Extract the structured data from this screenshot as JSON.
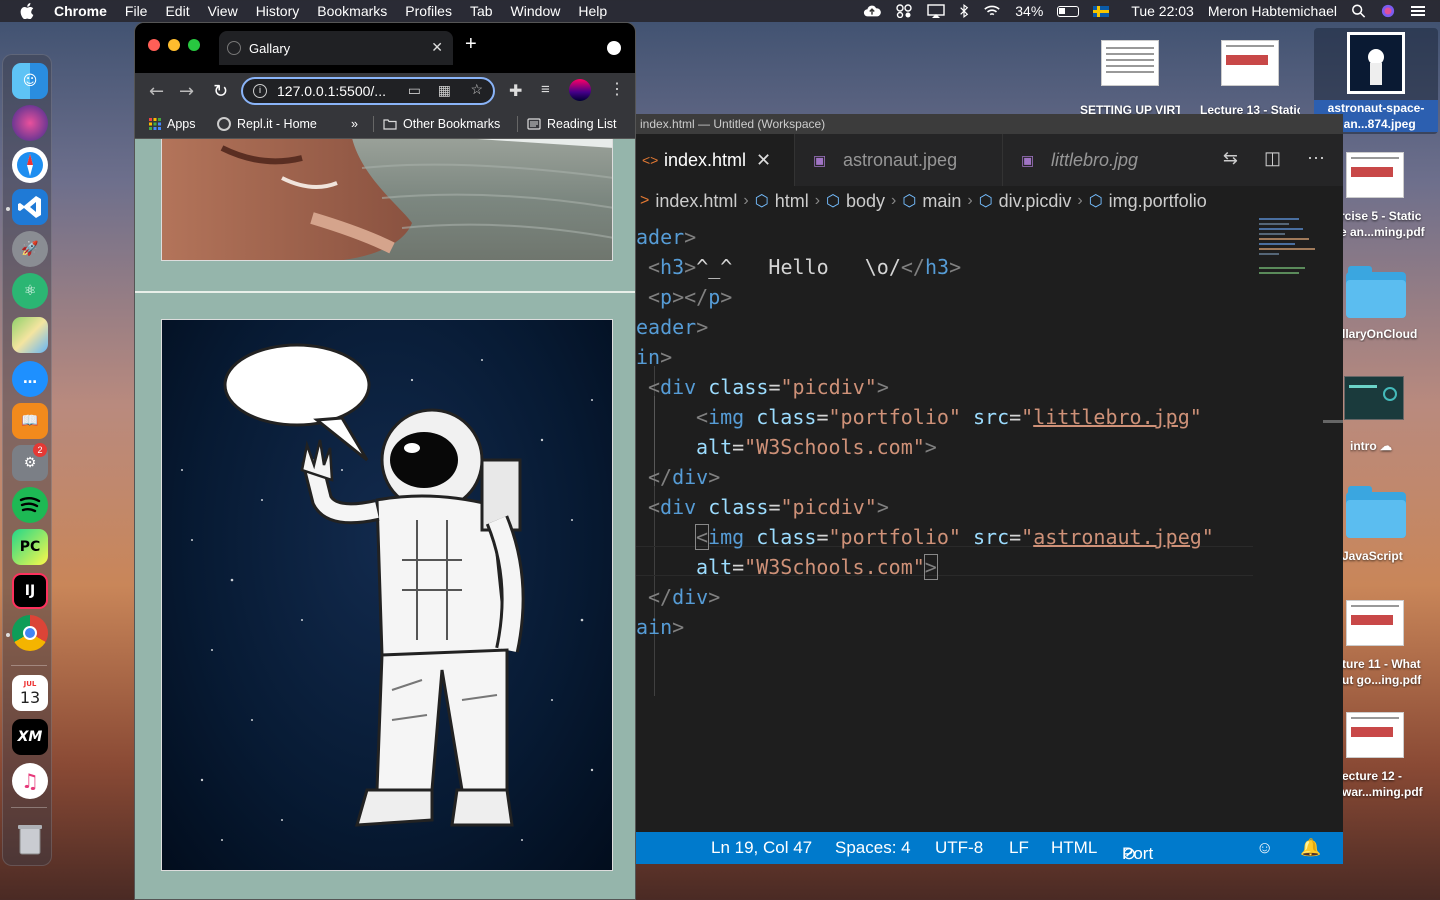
{
  "menubar": {
    "app": "Chrome",
    "items": [
      "File",
      "Edit",
      "View",
      "History",
      "Bookmarks",
      "Profiles",
      "Tab",
      "Window",
      "Help"
    ],
    "battery": "34%",
    "clock": "Tue 22:03",
    "user": "Meron Habtemichael"
  },
  "dock": {
    "badge": "2",
    "calendar_month": "JUL",
    "calendar_day": "13",
    "xm": "XM",
    "pc": "PC",
    "ij": "IJ"
  },
  "desktop": {
    "items": [
      {
        "label": "SETTING UP VIRT..."
      },
      {
        "label": "Lecture 13 - Static"
      },
      {
        "label": "astronaut-space-",
        "label2": "han...874.jpeg"
      },
      {
        "label": "rcise 5 - Static",
        "label2": "e an...ming.pdf"
      },
      {
        "label": "llaryOnCloud"
      },
      {
        "label": "intro"
      },
      {
        "label": "JavaScript"
      },
      {
        "label": "ture 11 - What",
        "label2": "ut go...ing.pdf"
      },
      {
        "label": "ecture 12 -",
        "label2": "war...ming.pdf"
      }
    ]
  },
  "chrome": {
    "tab_title": "Gallary",
    "url": "127.0.0.1:5500/...",
    "bookmarks": [
      "Apps",
      "Repl.it - Home",
      "»",
      "Other Bookmarks",
      "Reading List"
    ]
  },
  "vscode": {
    "title": "index.html — Untitled (Workspace)",
    "tabs": [
      "index.html",
      "astronaut.jpeg",
      "littlebro.jpg"
    ],
    "breadcrumbs": [
      "index.html",
      "html",
      "body",
      "main",
      "div.picdiv",
      "img.portfolio"
    ],
    "code": {
      "l1": "ader",
      "l2_tag": "h3",
      "l2_text": "^_^   Hello   \\o/",
      "l3_tag": "p",
      "l4": "eader",
      "l5": "in",
      "div": "div",
      "class_attr": "class",
      "picdiv": "\"picdiv\"",
      "img": "img",
      "portfolio": "\"portfolio\"",
      "src_attr": "src",
      "src1": "littlebro.jpg",
      "src2": "astronaut.jpeg",
      "alt_attr": "alt",
      "alt_val": "\"W3Schools.com\"",
      "l14": "ain"
    },
    "status": {
      "position": "Ln 19, Col 47",
      "spaces": "Spaces: 4",
      "encoding": "UTF-8",
      "eol": "LF",
      "language": "HTML",
      "port": "Port : 5500"
    }
  }
}
